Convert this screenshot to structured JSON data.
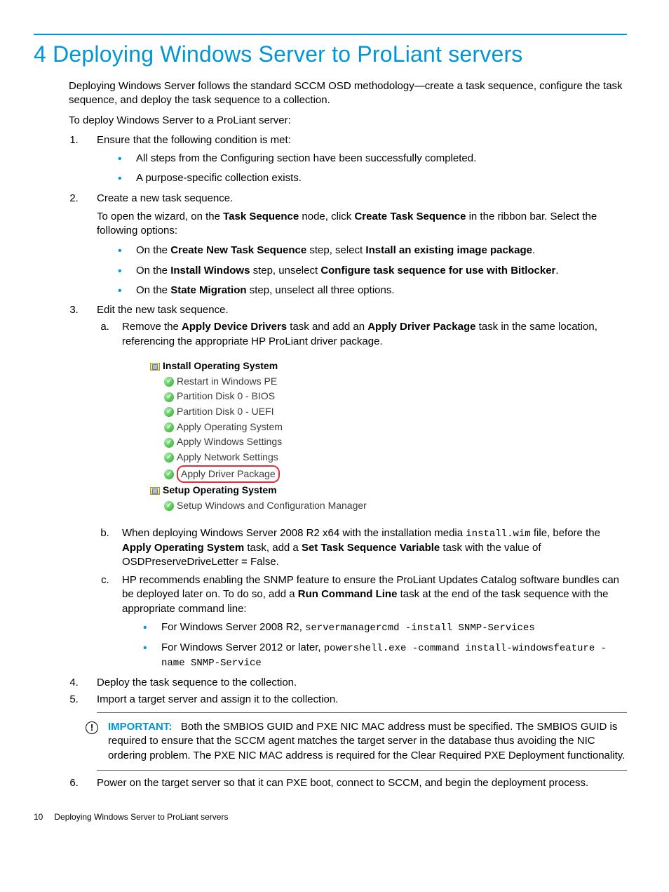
{
  "heading": "4 Deploying Windows Server to ProLiant servers",
  "intro": "Deploying Windows Server follows the standard SCCM OSD methodology—create a task sequence, configure the task sequence, and deploy the task sequence to a collection.",
  "lead": "To deploy Windows Server to a ProLiant server:",
  "step1": "Ensure that the following condition is met:",
  "step1_b1": "All steps from the Configuring section have been successfully completed.",
  "step1_b2": "A purpose-specific collection exists.",
  "step2": "Create a new task sequence.",
  "step2_p_a": "To open the wizard, on the ",
  "step2_p_b": "Task Sequence",
  "step2_p_c": " node, click ",
  "step2_p_d": "Create Task Sequence",
  "step2_p_e": " in the ribbon bar. Select the following options:",
  "s2b1_a": "On the ",
  "s2b1_b": "Create New Task Sequence",
  "s2b1_c": " step, select ",
  "s2b1_d": "Install an existing image package",
  "s2b1_e": ".",
  "s2b2_a": "On the ",
  "s2b2_b": "Install Windows",
  "s2b2_c": " step, unselect ",
  "s2b2_d": "Configure task sequence for use with Bitlocker",
  "s2b2_e": ".",
  "s2b3_a": "On the ",
  "s2b3_b": "State Migration",
  "s2b3_c": " step, unselect all three options.",
  "step3": "Edit the new task sequence.",
  "s3a_a": "Remove the ",
  "s3a_b": "Apply Device Drivers",
  "s3a_c": " task and add an ",
  "s3a_d": "Apply Driver Package",
  "s3a_e": " task in the same location, referencing the appropriate HP ProLiant driver package.",
  "tree": {
    "g1": "Install Operating System",
    "i1": "Restart in Windows PE",
    "i2": "Partition Disk 0 - BIOS",
    "i3": "Partition Disk 0 - UEFI",
    "i4": "Apply Operating System",
    "i5": "Apply Windows Settings",
    "i6": "Apply Network Settings",
    "i7": "Apply Driver Package",
    "g2": "Setup Operating System",
    "i8": "Setup Windows and Configuration Manager"
  },
  "s3b_a": "When deploying Windows Server 2008 R2 x64 with the installation media ",
  "s3b_code1": "install.wim",
  "s3b_b": " file, before the ",
  "s3b_bold1": "Apply Operating System",
  "s3b_c": " task, add a ",
  "s3b_bold2": "Set Task Sequence Variable",
  "s3b_d": " task with the value of OSDPreserveDriveLetter = False.",
  "s3c_a": "HP recommends enabling the SNMP feature to ensure the ProLiant Updates Catalog software bundles can be deployed later on. To do so, add a ",
  "s3c_bold": "Run Command Line",
  "s3c_b": " task at the end of the task sequence with the appropriate command line:",
  "s3c_b1_a": "For Windows Server 2008 R2, ",
  "s3c_b1_code": "servermanagercmd -install SNMP-Services",
  "s3c_b2_a": "For Windows Server 2012 or later, ",
  "s3c_b2_code": "powershell.exe -command install-windowsfeature -name SNMP-Service",
  "step4": "Deploy the task sequence to the collection.",
  "step5": "Import a target server and assign it to the collection.",
  "callout_label": "IMPORTANT:",
  "callout_body": "Both the SMBIOS GUID and PXE NIC MAC address must be specified. The SMBIOS GUID is required to ensure that the SCCM agent matches the target server in the database thus avoiding the NIC ordering problem. The PXE NIC MAC address is required for the Clear Required PXE Deployment functionality.",
  "step6": "Power on the target server so that it can PXE boot, connect to SCCM, and begin the deployment process.",
  "footer_page": "10",
  "footer_title": "Deploying Windows Server to ProLiant servers"
}
